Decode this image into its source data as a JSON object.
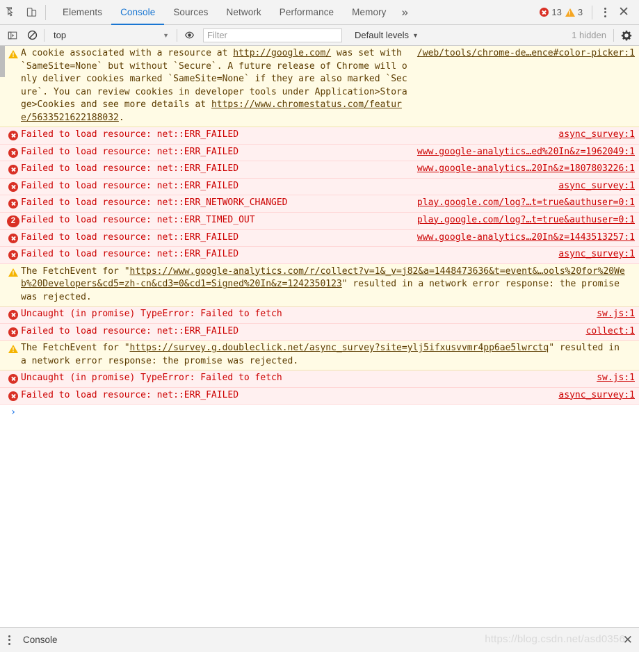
{
  "tabbar": {
    "icons": {
      "inspect": "inspect-element-icon",
      "device": "device-toolbar-icon",
      "more_tabs": "»",
      "close": "✕"
    },
    "tabs": [
      {
        "label": "Elements",
        "selected": false
      },
      {
        "label": "Console",
        "selected": true
      },
      {
        "label": "Sources",
        "selected": false
      },
      {
        "label": "Network",
        "selected": false
      },
      {
        "label": "Performance",
        "selected": false
      },
      {
        "label": "Memory",
        "selected": false
      }
    ],
    "error_count": "13",
    "warning_count": "3"
  },
  "filterbar": {
    "sidebar_toggle": "console-sidebar-icon",
    "clear_console": "clear-console-icon",
    "context": "top",
    "context_caret": "▼",
    "eye_icon": "live-expression-icon",
    "filter_value": "",
    "filter_placeholder": "Filter",
    "levels_label": "Default levels",
    "levels_caret": "▼",
    "hidden_label": "1 hidden",
    "settings_icon": "gear-icon"
  },
  "console": {
    "messages": [
      {
        "level": "warn",
        "icon": "warning-icon",
        "parts": [
          {
            "t": "A cookie associated with a resource at ",
            "link": false
          },
          {
            "t": "http://google.com/",
            "link": true
          },
          {
            "t": " was set with `SameSite=None` but without `Secure`. A future release of Chrome will only deliver cookies marked `SameSite=None` if they are also marked `Secure`. You can review cookies in developer tools under Application>Storage>Cookies and see more details at ",
            "link": false
          },
          {
            "t": "https://www.chromestatus.com/feature/5633521622188032",
            "link": true
          },
          {
            "t": ".",
            "link": false
          }
        ],
        "source": "/web/tools/chrome-de…ence#color-picker:1"
      },
      {
        "level": "err",
        "icon": "error-icon",
        "text": "Failed to load resource: net::ERR_FAILED",
        "source": "async_survey:1"
      },
      {
        "level": "err",
        "icon": "error-icon",
        "text": "Failed to load resource: net::ERR_FAILED",
        "source": "www.google-analytics…ed%20In&z=1962049:1"
      },
      {
        "level": "err",
        "icon": "error-icon",
        "text": "Failed to load resource: net::ERR_FAILED",
        "source": "www.google-analytics…20In&z=1807803226:1"
      },
      {
        "level": "err",
        "icon": "error-icon",
        "text": "Failed to load resource: net::ERR_FAILED",
        "source": "async_survey:1"
      },
      {
        "level": "err",
        "icon": "error-icon",
        "text": "Failed to load resource: net::ERR_NETWORK_CHANGED",
        "source": "play.google.com/log?…t=true&authuser=0:1"
      },
      {
        "level": "err",
        "icon": "repeat-count-badge",
        "count": "2",
        "text": "Failed to load resource: net::ERR_TIMED_OUT",
        "source": "play.google.com/log?…t=true&authuser=0:1"
      },
      {
        "level": "err",
        "icon": "error-icon",
        "text": "Failed to load resource: net::ERR_FAILED",
        "source": "www.google-analytics…20In&z=1443513257:1"
      },
      {
        "level": "err",
        "icon": "error-icon",
        "text": "Failed to load resource: net::ERR_FAILED",
        "source": "async_survey:1"
      },
      {
        "level": "warn",
        "icon": "warning-icon",
        "parts": [
          {
            "t": "The FetchEvent for \"",
            "link": false
          },
          {
            "t": "https://www.google-analytics.com/r/collect?v=1&_v=j82&a=1448473636&t=event&…ools%20for%20Web%20Developers&cd5=zh-cn&cd3=0&cd1=Signed%20In&z=1242350123",
            "link": true
          },
          {
            "t": "\" resulted in a network error response: the promise was rejected.",
            "link": false
          }
        ],
        "source": ""
      },
      {
        "level": "err",
        "icon": "error-icon",
        "text": "Uncaught (in promise) TypeError: Failed to fetch",
        "source": "sw.js:1"
      },
      {
        "level": "err",
        "icon": "error-icon",
        "text": "Failed to load resource: net::ERR_FAILED",
        "source": "collect:1"
      },
      {
        "level": "warn",
        "icon": "warning-icon",
        "parts": [
          {
            "t": "The FetchEvent for \"",
            "link": false
          },
          {
            "t": "https://survey.g.doubleclick.net/async_survey?site=ylj5ifxusvvmr4pp6ae5lwrctq",
            "link": true
          },
          {
            "t": "\" resulted in a network error response: the promise was rejected.",
            "link": false
          }
        ],
        "source": ""
      },
      {
        "level": "err",
        "icon": "error-icon",
        "text": "Uncaught (in promise) TypeError: Failed to fetch",
        "source": "sw.js:1"
      },
      {
        "level": "err",
        "icon": "error-icon",
        "text": "Failed to load resource: net::ERR_FAILED",
        "source": "async_survey:1"
      }
    ],
    "prompt_chevron": "›",
    "prompt_value": ""
  },
  "drawer": {
    "tab_label": "Console",
    "close_icon": "✕",
    "watermark": "https://blog.csdn.net/asd0356"
  },
  "colors": {
    "accent": "#1976d2",
    "error": "#d93025",
    "warning": "#f5b400",
    "error_bg": "#fff0f0",
    "warning_bg": "#fffbe5",
    "toolbar_bg": "#f3f3f3"
  }
}
